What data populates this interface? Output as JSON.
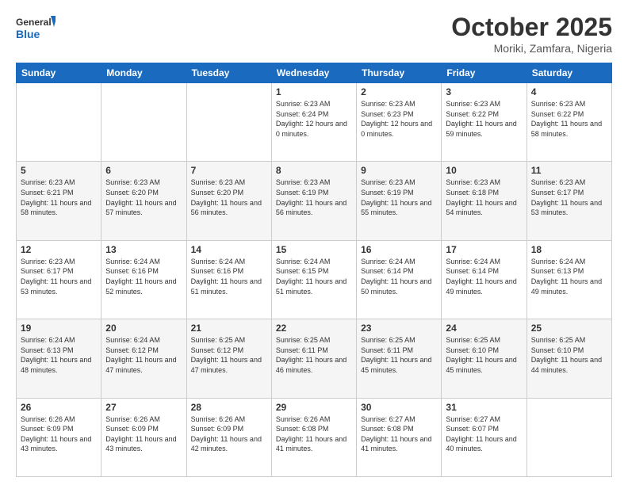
{
  "header": {
    "logo_general": "General",
    "logo_blue": "Blue",
    "title": "October 2025",
    "subtitle": "Moriki, Zamfara, Nigeria"
  },
  "weekdays": [
    "Sunday",
    "Monday",
    "Tuesday",
    "Wednesday",
    "Thursday",
    "Friday",
    "Saturday"
  ],
  "weeks": [
    [
      {
        "day": "",
        "sunrise": "",
        "sunset": "",
        "daylight": ""
      },
      {
        "day": "",
        "sunrise": "",
        "sunset": "",
        "daylight": ""
      },
      {
        "day": "",
        "sunrise": "",
        "sunset": "",
        "daylight": ""
      },
      {
        "day": "1",
        "sunrise": "Sunrise: 6:23 AM",
        "sunset": "Sunset: 6:24 PM",
        "daylight": "Daylight: 12 hours and 0 minutes."
      },
      {
        "day": "2",
        "sunrise": "Sunrise: 6:23 AM",
        "sunset": "Sunset: 6:23 PM",
        "daylight": "Daylight: 12 hours and 0 minutes."
      },
      {
        "day": "3",
        "sunrise": "Sunrise: 6:23 AM",
        "sunset": "Sunset: 6:22 PM",
        "daylight": "Daylight: 11 hours and 59 minutes."
      },
      {
        "day": "4",
        "sunrise": "Sunrise: 6:23 AM",
        "sunset": "Sunset: 6:22 PM",
        "daylight": "Daylight: 11 hours and 58 minutes."
      }
    ],
    [
      {
        "day": "5",
        "sunrise": "Sunrise: 6:23 AM",
        "sunset": "Sunset: 6:21 PM",
        "daylight": "Daylight: 11 hours and 58 minutes."
      },
      {
        "day": "6",
        "sunrise": "Sunrise: 6:23 AM",
        "sunset": "Sunset: 6:20 PM",
        "daylight": "Daylight: 11 hours and 57 minutes."
      },
      {
        "day": "7",
        "sunrise": "Sunrise: 6:23 AM",
        "sunset": "Sunset: 6:20 PM",
        "daylight": "Daylight: 11 hours and 56 minutes."
      },
      {
        "day": "8",
        "sunrise": "Sunrise: 6:23 AM",
        "sunset": "Sunset: 6:19 PM",
        "daylight": "Daylight: 11 hours and 56 minutes."
      },
      {
        "day": "9",
        "sunrise": "Sunrise: 6:23 AM",
        "sunset": "Sunset: 6:19 PM",
        "daylight": "Daylight: 11 hours and 55 minutes."
      },
      {
        "day": "10",
        "sunrise": "Sunrise: 6:23 AM",
        "sunset": "Sunset: 6:18 PM",
        "daylight": "Daylight: 11 hours and 54 minutes."
      },
      {
        "day": "11",
        "sunrise": "Sunrise: 6:23 AM",
        "sunset": "Sunset: 6:17 PM",
        "daylight": "Daylight: 11 hours and 53 minutes."
      }
    ],
    [
      {
        "day": "12",
        "sunrise": "Sunrise: 6:23 AM",
        "sunset": "Sunset: 6:17 PM",
        "daylight": "Daylight: 11 hours and 53 minutes."
      },
      {
        "day": "13",
        "sunrise": "Sunrise: 6:24 AM",
        "sunset": "Sunset: 6:16 PM",
        "daylight": "Daylight: 11 hours and 52 minutes."
      },
      {
        "day": "14",
        "sunrise": "Sunrise: 6:24 AM",
        "sunset": "Sunset: 6:16 PM",
        "daylight": "Daylight: 11 hours and 51 minutes."
      },
      {
        "day": "15",
        "sunrise": "Sunrise: 6:24 AM",
        "sunset": "Sunset: 6:15 PM",
        "daylight": "Daylight: 11 hours and 51 minutes."
      },
      {
        "day": "16",
        "sunrise": "Sunrise: 6:24 AM",
        "sunset": "Sunset: 6:14 PM",
        "daylight": "Daylight: 11 hours and 50 minutes."
      },
      {
        "day": "17",
        "sunrise": "Sunrise: 6:24 AM",
        "sunset": "Sunset: 6:14 PM",
        "daylight": "Daylight: 11 hours and 49 minutes."
      },
      {
        "day": "18",
        "sunrise": "Sunrise: 6:24 AM",
        "sunset": "Sunset: 6:13 PM",
        "daylight": "Daylight: 11 hours and 49 minutes."
      }
    ],
    [
      {
        "day": "19",
        "sunrise": "Sunrise: 6:24 AM",
        "sunset": "Sunset: 6:13 PM",
        "daylight": "Daylight: 11 hours and 48 minutes."
      },
      {
        "day": "20",
        "sunrise": "Sunrise: 6:24 AM",
        "sunset": "Sunset: 6:12 PM",
        "daylight": "Daylight: 11 hours and 47 minutes."
      },
      {
        "day": "21",
        "sunrise": "Sunrise: 6:25 AM",
        "sunset": "Sunset: 6:12 PM",
        "daylight": "Daylight: 11 hours and 47 minutes."
      },
      {
        "day": "22",
        "sunrise": "Sunrise: 6:25 AM",
        "sunset": "Sunset: 6:11 PM",
        "daylight": "Daylight: 11 hours and 46 minutes."
      },
      {
        "day": "23",
        "sunrise": "Sunrise: 6:25 AM",
        "sunset": "Sunset: 6:11 PM",
        "daylight": "Daylight: 11 hours and 45 minutes."
      },
      {
        "day": "24",
        "sunrise": "Sunrise: 6:25 AM",
        "sunset": "Sunset: 6:10 PM",
        "daylight": "Daylight: 11 hours and 45 minutes."
      },
      {
        "day": "25",
        "sunrise": "Sunrise: 6:25 AM",
        "sunset": "Sunset: 6:10 PM",
        "daylight": "Daylight: 11 hours and 44 minutes."
      }
    ],
    [
      {
        "day": "26",
        "sunrise": "Sunrise: 6:26 AM",
        "sunset": "Sunset: 6:09 PM",
        "daylight": "Daylight: 11 hours and 43 minutes."
      },
      {
        "day": "27",
        "sunrise": "Sunrise: 6:26 AM",
        "sunset": "Sunset: 6:09 PM",
        "daylight": "Daylight: 11 hours and 43 minutes."
      },
      {
        "day": "28",
        "sunrise": "Sunrise: 6:26 AM",
        "sunset": "Sunset: 6:09 PM",
        "daylight": "Daylight: 11 hours and 42 minutes."
      },
      {
        "day": "29",
        "sunrise": "Sunrise: 6:26 AM",
        "sunset": "Sunset: 6:08 PM",
        "daylight": "Daylight: 11 hours and 41 minutes."
      },
      {
        "day": "30",
        "sunrise": "Sunrise: 6:27 AM",
        "sunset": "Sunset: 6:08 PM",
        "daylight": "Daylight: 11 hours and 41 minutes."
      },
      {
        "day": "31",
        "sunrise": "Sunrise: 6:27 AM",
        "sunset": "Sunset: 6:07 PM",
        "daylight": "Daylight: 11 hours and 40 minutes."
      },
      {
        "day": "",
        "sunrise": "",
        "sunset": "",
        "daylight": ""
      }
    ]
  ]
}
